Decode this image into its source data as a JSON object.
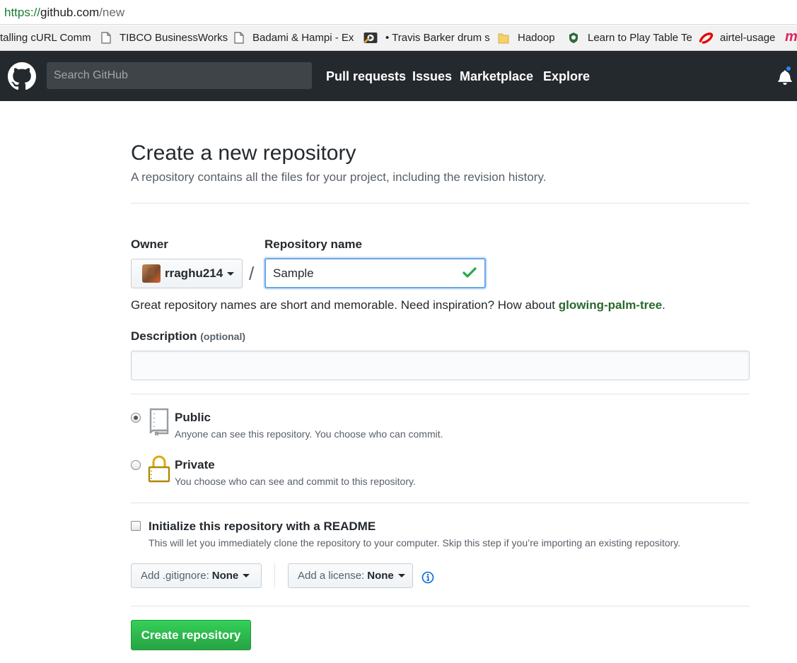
{
  "browser": {
    "url_protocol": "https://",
    "url_host": "github.com",
    "url_path": "/new",
    "bookmarks": [
      {
        "label": "talling cURL Comm",
        "icon": "none"
      },
      {
        "label": "TIBCO BusinessWorks",
        "icon": "page-icon"
      },
      {
        "label": "Badami & Hampi - Ex",
        "icon": "page-icon"
      },
      {
        "label": "• Travis Barker drum s",
        "icon": "video-icon"
      },
      {
        "label": "Hadoop",
        "icon": "folder-icon"
      },
      {
        "label": "Learn to Play Table Te",
        "icon": "shield-icon"
      },
      {
        "label": "airtel-usage",
        "icon": "airtel-icon"
      }
    ]
  },
  "header": {
    "search_placeholder": "Search GitHub",
    "nav": [
      "Pull requests",
      "Issues",
      "Marketplace",
      "Explore"
    ]
  },
  "page": {
    "title": "Create a new repository",
    "subtitle": "A repository contains all the files for your project, including the revision history."
  },
  "form": {
    "owner_label": "Owner",
    "owner_value": "rraghu214",
    "slash": "/",
    "repo_label": "Repository name",
    "repo_value": "Sample",
    "hint_prefix": "Great repository names are short and memorable. Need inspiration? How about ",
    "hint_suggestion": "glowing-palm-tree",
    "hint_suffix": ".",
    "description_label": "Description",
    "description_optional": "(optional)",
    "description_value": "",
    "visibility": [
      {
        "title": "Public",
        "desc": "Anyone can see this repository. You choose who can commit.",
        "checked": true
      },
      {
        "title": "Private",
        "desc": "You choose who can see and commit to this repository.",
        "checked": false
      }
    ],
    "readme_label": "Initialize this repository with a README",
    "readme_desc": "This will let you immediately clone the repository to your computer. Skip this step if you’re importing an existing repository.",
    "gitignore_label": "Add .gitignore:",
    "gitignore_value": "None",
    "license_label": "Add a license:",
    "license_value": "None",
    "submit_label": "Create repository"
  },
  "colors": {
    "header_bg": "#24292e",
    "primary_green": "#28a745",
    "suggestion_green": "#28692c",
    "focus_blue": "#6aa5e8"
  }
}
